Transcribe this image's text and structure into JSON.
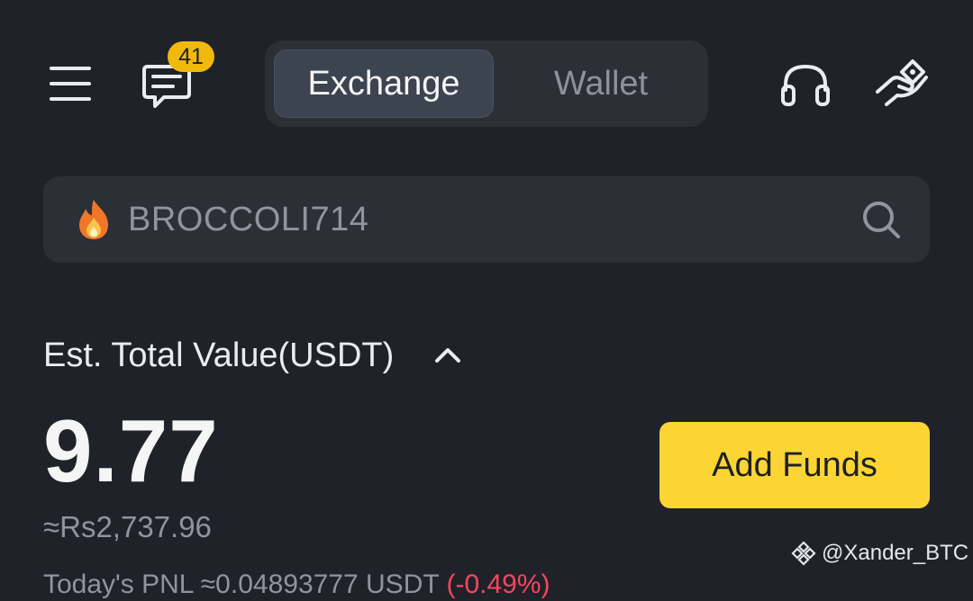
{
  "header": {
    "menu_icon": "hamburger-menu-icon",
    "messages_icon": "chat-icon",
    "messages_badge": "41",
    "tabs": [
      {
        "label": "Exchange",
        "active": true
      },
      {
        "label": "Wallet",
        "active": false
      }
    ],
    "support_icon": "headset-icon",
    "referral_icon": "hand-gift-icon"
  },
  "search": {
    "icon": "fire-icon",
    "placeholder": "BROCCOLI714",
    "search_icon": "search-icon"
  },
  "balance": {
    "label": "Est. Total Value(USDT)",
    "toggle_icon": "chevron-up-icon",
    "value": "9.77",
    "fiat_value": "≈Rs2,737.96",
    "add_funds_label": "Add Funds"
  },
  "pnl": {
    "label": "Today's PNL",
    "value": "≈0.04893777 USDT",
    "percent": "(-0.49%)"
  },
  "watermark": {
    "text": "@Xander_BTC",
    "icon": "binance-logo-icon"
  },
  "colors": {
    "background": "#1f2229",
    "surface": "#2b2f36",
    "accent": "#fcd535",
    "badge": "#f0b90b",
    "muted_text": "#8f959e",
    "negative": "#f6465d"
  }
}
